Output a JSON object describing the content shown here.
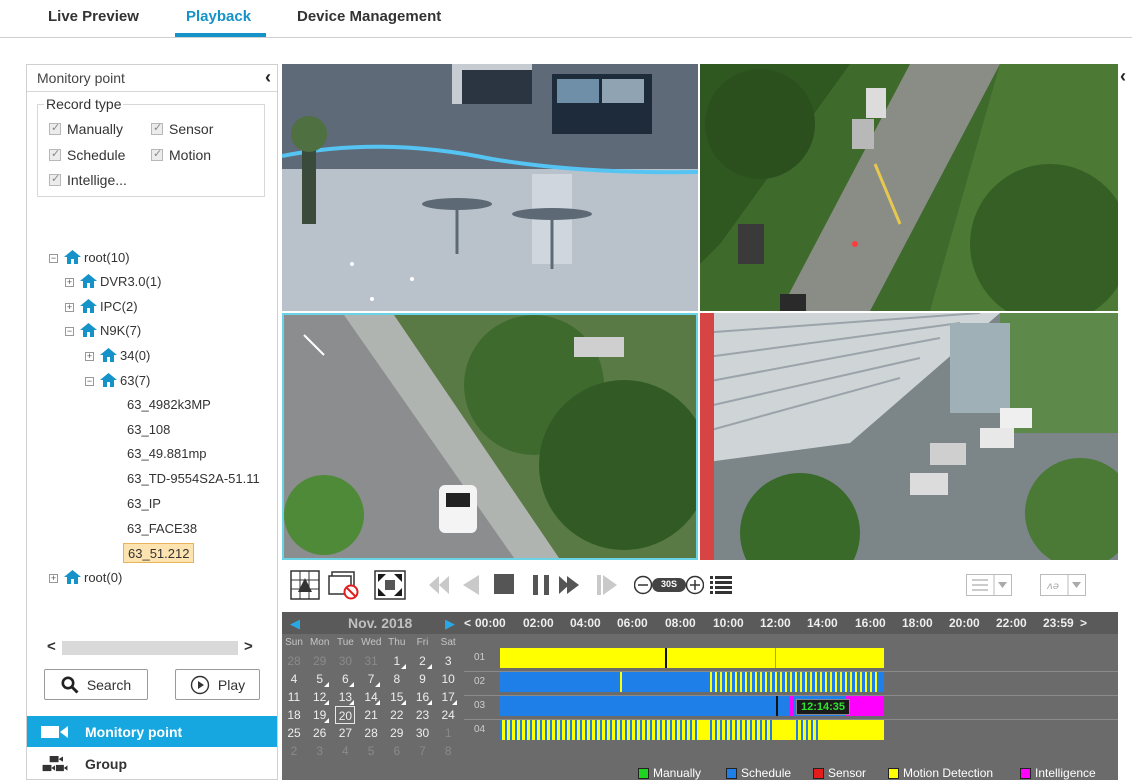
{
  "nav": {
    "tabs": [
      "Live Preview",
      "Playback",
      "Device Management"
    ],
    "active": "Playback"
  },
  "left_panel": {
    "title": "Monitory point",
    "record_type": {
      "legend": "Record type",
      "options": [
        {
          "label": "Manually",
          "checked": true
        },
        {
          "label": "Sensor",
          "checked": true
        },
        {
          "label": "Schedule",
          "checked": true
        },
        {
          "label": "Motion",
          "checked": true
        },
        {
          "label": "Intellige...",
          "checked": true
        }
      ]
    },
    "tree": [
      {
        "label": "root(10)",
        "expanded": true
      },
      {
        "label": "DVR3.0(1)",
        "expanded": false
      },
      {
        "label": "IPC(2)",
        "expanded": false
      },
      {
        "label": "N9K(7)",
        "expanded": true
      },
      {
        "label": "34(0)",
        "expanded": false
      },
      {
        "label": "63(7)",
        "expanded": true
      },
      {
        "label": "root(0)",
        "expanded": false
      }
    ],
    "channels": [
      "63_4982k3MP",
      "63_108",
      "63_49.881mp",
      "63_TD-9554S2A-51.11",
      "63_IP",
      "63_FACE38",
      "63_51.212"
    ],
    "selected_channel": "63_51.212",
    "search_label": "Search",
    "play_label": "Play",
    "bottom_nav": [
      "Monitory point",
      "Group"
    ]
  },
  "calendar": {
    "month_label": "Nov.",
    "year": "2018",
    "weekdays": [
      "Sun",
      "Mon",
      "Tue",
      "Wed",
      "Thu",
      "Fri",
      "Sat"
    ],
    "weeks": [
      [
        "28",
        "29",
        "30",
        "31",
        "1",
        "2",
        "3"
      ],
      [
        "4",
        "5",
        "6",
        "7",
        "8",
        "9",
        "10"
      ],
      [
        "11",
        "12",
        "13",
        "14",
        "15",
        "16",
        "17"
      ],
      [
        "18",
        "19",
        "20",
        "21",
        "22",
        "23",
        "24"
      ],
      [
        "25",
        "26",
        "27",
        "28",
        "29",
        "30",
        "1"
      ],
      [
        "2",
        "3",
        "4",
        "5",
        "6",
        "7",
        "8"
      ]
    ],
    "selected_day": "20"
  },
  "timeline": {
    "labels": [
      "00:00",
      "02:00",
      "04:00",
      "06:00",
      "08:00",
      "10:00",
      "12:00",
      "14:00",
      "16:00",
      "18:00",
      "20:00",
      "22:00",
      "23:59"
    ],
    "tracks": [
      "01",
      "02",
      "03",
      "04"
    ],
    "current_time": "12:14:35",
    "speed_label": "30S"
  },
  "legend": [
    {
      "label": "Manually",
      "color": "#21d321"
    },
    {
      "label": "Schedule",
      "color": "#1e7fe8"
    },
    {
      "label": "Sensor",
      "color": "#e51c1c"
    },
    {
      "label": "Motion Detection",
      "color": "#ffff00"
    },
    {
      "label": "Intelligence",
      "color": "#ff00ff"
    }
  ]
}
